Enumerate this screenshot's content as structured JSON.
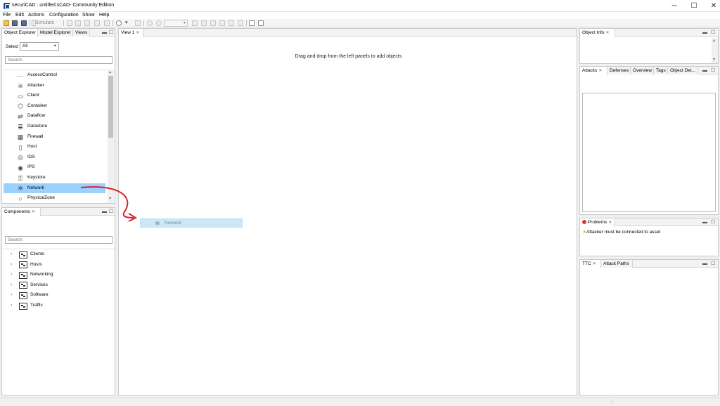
{
  "window": {
    "title": "securiCAD : untitled.sCAD- Community Edition",
    "minimize": "─",
    "maximize": "☐",
    "close": "✕"
  },
  "menu": [
    "File",
    "Edit",
    "Actions",
    "Configuration",
    "Show",
    "Help"
  ],
  "toolbar": {
    "simulate_label": "Simulate"
  },
  "object_explorer": {
    "tabs": [
      "Object Explorer",
      "Model Explorer",
      "Views"
    ],
    "select_label": "Select",
    "select_value": "All",
    "search_placeholder": "Search",
    "items": [
      {
        "label": "AccessControl",
        "icon": "access-control-icon",
        "glyph": "⋯"
      },
      {
        "label": "Attacker",
        "icon": "attacker-icon",
        "glyph": "☠"
      },
      {
        "label": "Client",
        "icon": "client-icon",
        "glyph": "▭"
      },
      {
        "label": "Container",
        "icon": "container-icon",
        "glyph": "⬡"
      },
      {
        "label": "Dataflow",
        "icon": "dataflow-icon",
        "glyph": "⇌"
      },
      {
        "label": "Datastore",
        "icon": "datastore-icon",
        "glyph": "≣"
      },
      {
        "label": "Firewall",
        "icon": "firewall-icon",
        "glyph": "▦"
      },
      {
        "label": "Host",
        "icon": "host-icon",
        "glyph": "▯"
      },
      {
        "label": "IDS",
        "icon": "ids-icon",
        "glyph": "◎"
      },
      {
        "label": "IPS",
        "icon": "ips-icon",
        "glyph": "◉"
      },
      {
        "label": "Keystore",
        "icon": "keystore-icon",
        "glyph": "⚿"
      },
      {
        "label": "Network",
        "icon": "network-icon",
        "glyph": "✲",
        "selected": true
      },
      {
        "label": "PhysicalZone",
        "icon": "physical-zone-icon",
        "glyph": "○"
      }
    ]
  },
  "components": {
    "tab": "Components",
    "search_placeholder": "Search",
    "items": [
      "Clients",
      "Hosts",
      "Networking",
      "Services",
      "Software",
      "Traffic"
    ]
  },
  "canvas": {
    "tab": "View 1",
    "hint": "Drag and drop from the left panels to add objects",
    "drag_label": "Network"
  },
  "object_info": {
    "tab": "Object Info"
  },
  "attacks": {
    "tabs": [
      "Attacks",
      "Defenses",
      "Overview",
      "Tags",
      "Object Det..."
    ]
  },
  "problems": {
    "tab": "Problems",
    "message": "Attacker must be connected to asset"
  },
  "ttc": {
    "tabs": [
      "TTC",
      "Attack Paths"
    ]
  },
  "colors": {
    "selection": "#99d1ff",
    "drag_bg": "#cce8f6",
    "arrow": "#e0202a",
    "warning": "#e8a000",
    "error": "#d9372b"
  }
}
